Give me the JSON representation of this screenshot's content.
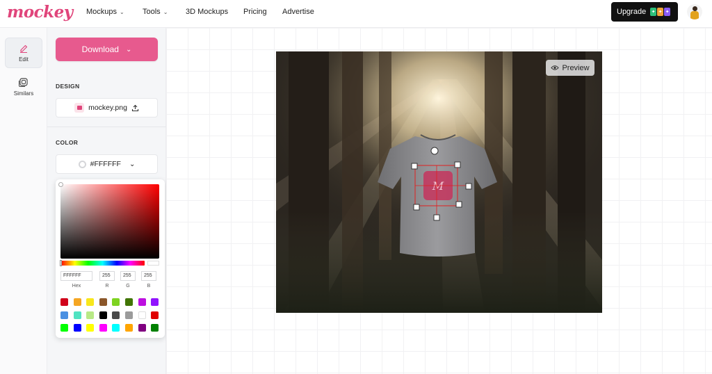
{
  "brand": {
    "logo_text": "mockey",
    "accent": "#e75a8e"
  },
  "nav": {
    "items": [
      {
        "label": "Mockups",
        "has_dropdown": true
      },
      {
        "label": "Tools",
        "has_dropdown": true
      },
      {
        "label": "3D Mockups",
        "has_dropdown": false
      },
      {
        "label": "Pricing",
        "has_dropdown": false
      },
      {
        "label": "Advertise",
        "has_dropdown": false
      }
    ],
    "upgrade_label": "Upgrade"
  },
  "rail": {
    "items": [
      {
        "label": "Edit",
        "icon": "pencil-icon",
        "active": true
      },
      {
        "label": "Similars",
        "icon": "similars-icon",
        "active": false
      }
    ]
  },
  "panel": {
    "download_label": "Download",
    "design_label": "DESIGN",
    "file_name": "mockey.png",
    "color_label": "COLOR",
    "color_value": "#FFFFFF"
  },
  "picker": {
    "hex": "FFFFFF",
    "r": "255",
    "g": "255",
    "b": "255",
    "labels": {
      "hex": "Hex",
      "r": "R",
      "g": "G",
      "b": "B"
    },
    "swatches": [
      "#d0021b",
      "#f5a623",
      "#f8e71c",
      "#8b572a",
      "#7ed321",
      "#417505",
      "#bd10e0",
      "#9013fe",
      "#4a90e2",
      "#50e3c2",
      "#b8e986",
      "#000000",
      "#4a4a4a",
      "#9b9b9b",
      "#ffffff",
      "#e00000",
      "#00ff00",
      "#0000ff",
      "#ffff00",
      "#ff00ff",
      "#00ffff",
      "#ffa500",
      "#800080",
      "#008000"
    ]
  },
  "canvas": {
    "preview_label": "Preview"
  }
}
